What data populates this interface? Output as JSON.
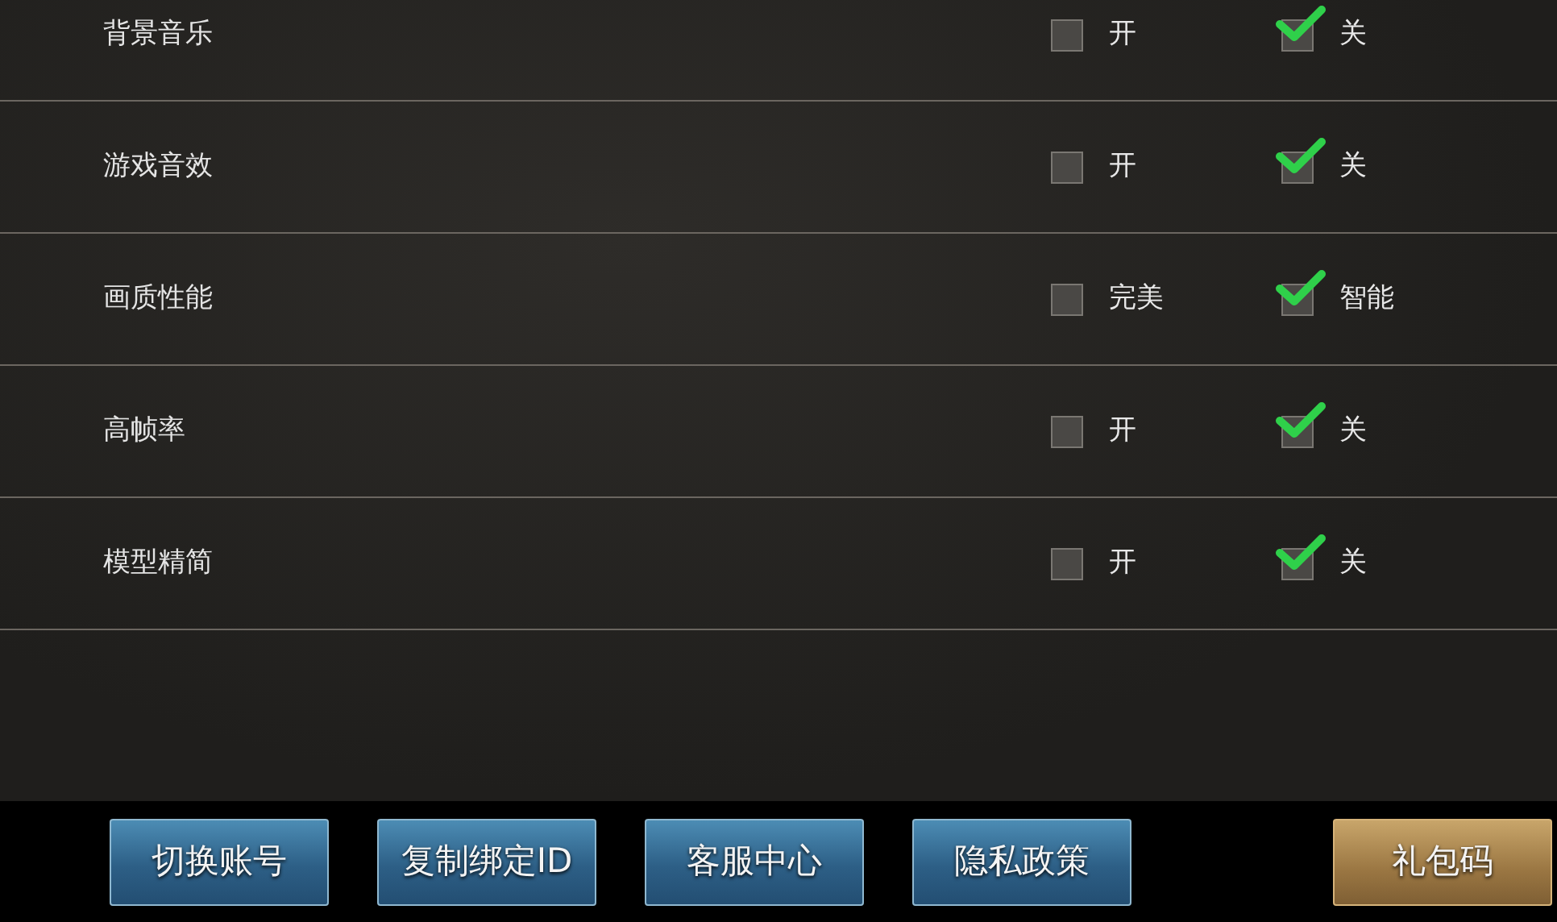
{
  "settings": [
    {
      "label": "背景音乐",
      "options": [
        {
          "text": "开",
          "checked": false
        },
        {
          "text": "关",
          "checked": true
        }
      ]
    },
    {
      "label": "游戏音效",
      "options": [
        {
          "text": "开",
          "checked": false
        },
        {
          "text": "关",
          "checked": true
        }
      ]
    },
    {
      "label": "画质性能",
      "options": [
        {
          "text": "完美",
          "checked": false
        },
        {
          "text": "智能",
          "checked": true
        }
      ]
    },
    {
      "label": "高帧率",
      "options": [
        {
          "text": "开",
          "checked": false
        },
        {
          "text": "关",
          "checked": true
        }
      ]
    },
    {
      "label": "模型精简",
      "options": [
        {
          "text": "开",
          "checked": false
        },
        {
          "text": "关",
          "checked": true
        }
      ]
    }
  ],
  "buttons": [
    {
      "text": "切换账号",
      "kind": "blue"
    },
    {
      "text": "复制绑定ID",
      "kind": "blue"
    },
    {
      "text": "客服中心",
      "kind": "blue"
    },
    {
      "text": "隐私政策",
      "kind": "blue"
    },
    {
      "text": "礼包码",
      "kind": "gold"
    }
  ]
}
